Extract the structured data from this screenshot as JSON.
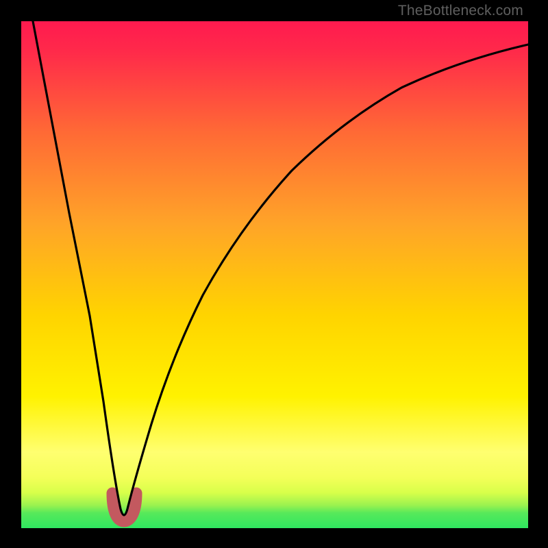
{
  "watermark": "TheBottleneck.com",
  "colors": {
    "gradient_top": "#ff1a4f",
    "gradient_mid_upper": "#ff7a2a",
    "gradient_mid": "#ffd400",
    "gradient_mid_lower": "#ffff66",
    "gradient_lower": "#d8ff4a",
    "gradient_green": "#2fe760",
    "curve": "#000000",
    "dip_stroke": "#c3595f",
    "frame": "#000000"
  },
  "chart_data": {
    "type": "line",
    "title": "",
    "xlabel": "",
    "ylabel": "",
    "xlim": [
      0,
      100
    ],
    "ylim": [
      0,
      100
    ],
    "series": [
      {
        "name": "main-curve",
        "x": [
          2,
          5,
          10,
          14,
          17,
          19,
          20,
          21,
          22,
          23,
          25,
          28,
          32,
          38,
          45,
          55,
          65,
          75,
          85,
          95,
          100
        ],
        "y": [
          100,
          80,
          54,
          33,
          17,
          6,
          2,
          1,
          2,
          6,
          17,
          34,
          50,
          64,
          74,
          82,
          87,
          90.5,
          93,
          94.5,
          95
        ]
      }
    ],
    "annotations": [
      {
        "name": "dip-highlight",
        "x_range": [
          19,
          23
        ],
        "y_range": [
          0,
          6
        ]
      }
    ],
    "gradient_bands_y": [
      {
        "y": 100,
        "color": "#ff1a4f"
      },
      {
        "y": 55,
        "color": "#ff9a2a"
      },
      {
        "y": 30,
        "color": "#ffe000"
      },
      {
        "y": 15,
        "color": "#ffff70"
      },
      {
        "y": 6,
        "color": "#d8ff4a"
      },
      {
        "y": 2,
        "color": "#2fe760"
      }
    ]
  }
}
